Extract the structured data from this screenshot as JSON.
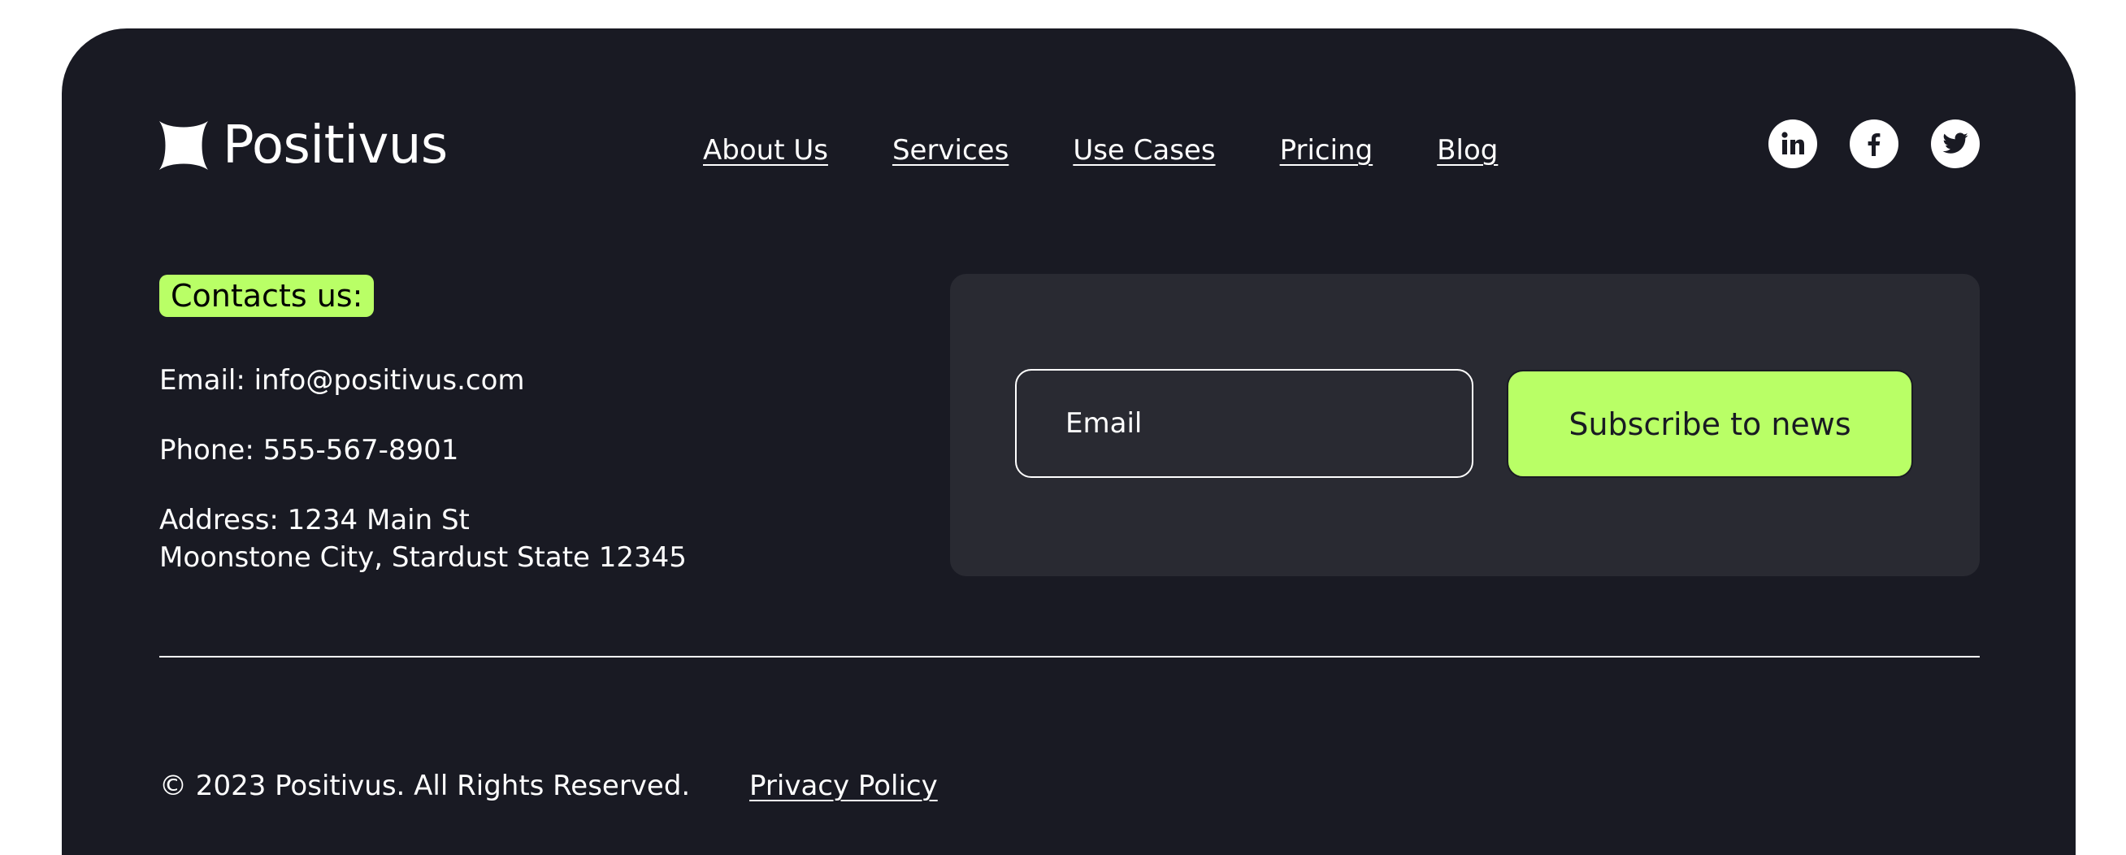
{
  "brand": {
    "name": "Positivus",
    "logo_icon": "star-burst-icon"
  },
  "nav": {
    "items": [
      {
        "label": "About Us"
      },
      {
        "label": "Services"
      },
      {
        "label": "Use Cases"
      },
      {
        "label": "Pricing"
      },
      {
        "label": "Blog"
      }
    ]
  },
  "social": {
    "items": [
      {
        "icon": "linkedin-icon"
      },
      {
        "icon": "facebook-icon"
      },
      {
        "icon": "twitter-icon"
      }
    ]
  },
  "contacts": {
    "heading": "Contacts us:",
    "email": "Email: info@positivus.com",
    "phone": "Phone: 555-567-8901",
    "address_line1": "Address: 1234 Main St",
    "address_line2": "Moonstone City, Stardust State 12345"
  },
  "subscribe": {
    "email_placeholder": "Email",
    "email_value": "",
    "button_label": "Subscribe to news"
  },
  "bottom": {
    "copyright": "© 2023 Positivus. All Rights Reserved.",
    "privacy_label": "Privacy Policy"
  },
  "colors": {
    "background": "#191a23",
    "panel": "#292a32",
    "accent": "#b9ff66",
    "text": "#ffffff"
  }
}
